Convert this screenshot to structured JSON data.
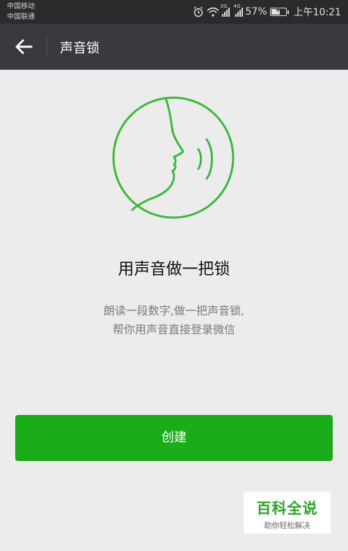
{
  "status_bar": {
    "carrier_1": "中国移动",
    "carrier_2": "中国联通",
    "signal_1_tag": "2G",
    "signal_2_tag": "4G",
    "battery": "57%",
    "time": "上午10:21"
  },
  "app_bar": {
    "title": "声音锁"
  },
  "main": {
    "headline": "用声音做一把锁",
    "description_line_1": "朗读一段数字,做一把声音锁,",
    "description_line_2": "帮你用声音直接登录微信",
    "create_button": "创建"
  },
  "watermark": {
    "title": "百科全说",
    "subtitle": "助你轻松解决"
  },
  "colors": {
    "accent_green": "#1aad19",
    "illustration_green": "#3ab83a",
    "app_bar": "#393a3f",
    "background": "#ececec"
  }
}
